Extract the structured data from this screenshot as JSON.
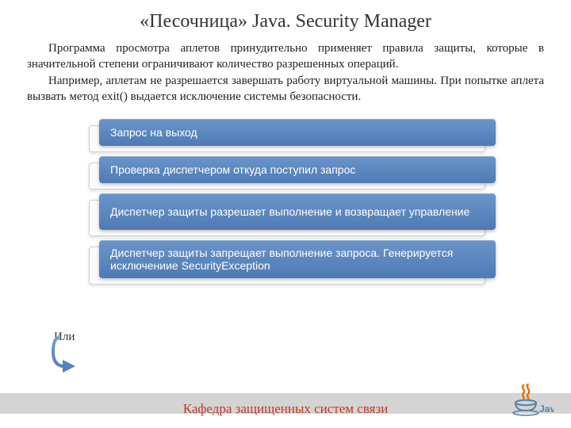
{
  "title": "«Песочница» Java. Security Manager",
  "paragraphs": {
    "p1": "Программа просмотра аплетов принудительно применяет правила защиты, которые в значительной степени ограничивают количество разрешенных операций.",
    "p2": "Например, аплетам не разрешается завершать работу виртуальной машины. При попытке аплета вызвать метод exit() выдается исключение системы безопасности."
  },
  "steps": [
    "Запрос на выход",
    "Проверка диспетчером  откуда поступил запрос",
    "Диспетчер защиты разрешает выполнение и возвращает управление",
    "Диспетчер защиты запрещает выполнение запроса. Генерируется исключениие SecurityException"
  ],
  "or_label": "Или",
  "footer": "Кафедра защищенных систем связи",
  "logo_text": "Java"
}
